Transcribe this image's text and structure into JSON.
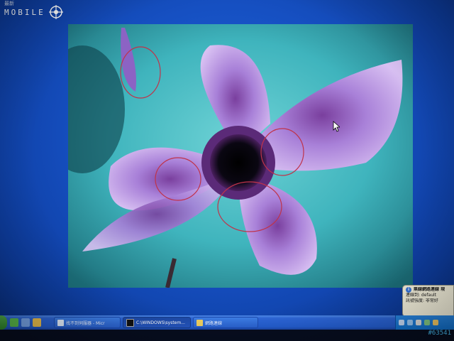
{
  "logo": {
    "text": "MOBILE"
  },
  "header": {
    "sliver_text": "最新"
  },
  "photo": {
    "name": "cyclamen flower wallpaper"
  },
  "balloon": {
    "title": "無線網路連線 現",
    "line1": "連線到: default",
    "line2": "訊號強度: 非常好"
  },
  "taskbar": {
    "buttons": [
      {
        "label": "找不到伺服器 - Micr",
        "state": "inactive",
        "icon": "browser-icon"
      },
      {
        "label": "C:\\WINDOWS\\system...",
        "state": "active",
        "icon": "cmd-icon"
      },
      {
        "label": "網路連線",
        "state": "inactive",
        "icon": "network-folder-icon"
      }
    ]
  },
  "watermark": {
    "text": "#63541"
  },
  "colors": {
    "desktop": "#1650c2",
    "taskbar": "#245ed0",
    "tray": "#1276d6",
    "balloon": "#fffbe6",
    "petal": "#b58fe0"
  }
}
